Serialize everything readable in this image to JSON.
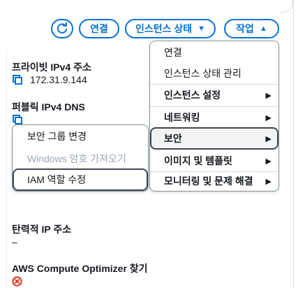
{
  "header": {
    "refresh_icon": "refresh-icon",
    "connect_label": "연결",
    "instance_state_label": "인스턴스 상태",
    "actions_label": "작업",
    "accent_color": "#0972d3"
  },
  "details": {
    "private_ipv4_label": "프라이빗 IPv4 주소",
    "private_ipv4_value": "172.31.9.144",
    "public_ipv4_dns_label": "퍼블릭 IPv4 DNS",
    "elastic_ip_label": "탄력적 IP 주소",
    "elastic_ip_value": "–",
    "compute_optimizer_label": "AWS Compute Optimizer 찾기",
    "copy_icon": "copy-icon",
    "error_icon": "error-icon"
  },
  "actions_menu": {
    "items": [
      {
        "label": "연결"
      },
      {
        "label": "인스턴스 상태 관리"
      },
      {
        "label": "인스턴스 설정",
        "submenu": true
      },
      {
        "label": "네트워킹",
        "submenu": true
      },
      {
        "label": "보안",
        "submenu": true,
        "active": true
      },
      {
        "label": "이미지 및 템플릿",
        "submenu": true
      },
      {
        "label": "모니터링 및 문제 해결",
        "submenu": true
      }
    ]
  },
  "security_submenu": {
    "items": [
      {
        "label": "보안 그룹 변경"
      },
      {
        "label": "Windows 암호 가져오기",
        "disabled": true
      },
      {
        "label": "IAM 역할 수정",
        "focused": true
      }
    ]
  }
}
